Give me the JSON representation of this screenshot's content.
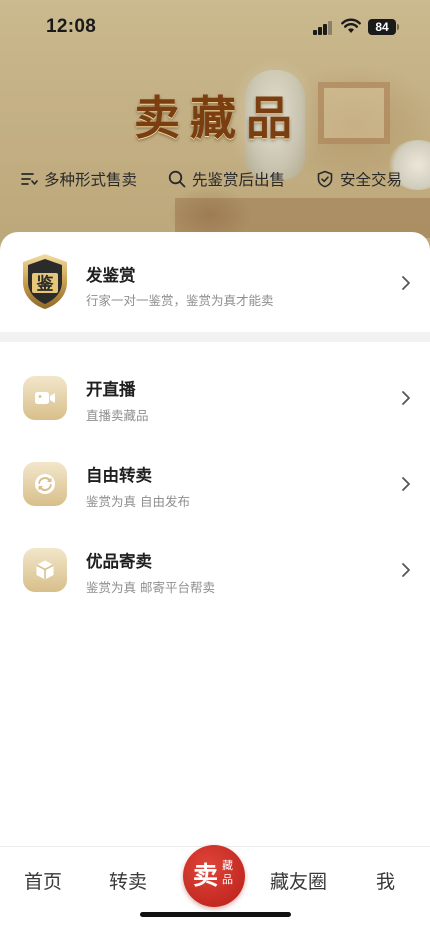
{
  "status_bar": {
    "time": "12:08",
    "battery": "84"
  },
  "hero": {
    "title": "卖藏品",
    "features": [
      {
        "icon": "list-filter-icon",
        "label": "多种形式售卖"
      },
      {
        "icon": "search-icon",
        "label": "先鉴赏后出售"
      },
      {
        "icon": "shield-check-icon",
        "label": "安全交易"
      }
    ]
  },
  "appraisal": {
    "badge_char": "鉴",
    "title": "发鉴赏",
    "subtitle": "行家一对一鉴赏，鉴赏为真才能卖"
  },
  "options": [
    {
      "icon": "video-camera-icon",
      "title": "开直播",
      "subtitle": "直播卖藏品"
    },
    {
      "icon": "transfer-icon",
      "title": "自由转卖",
      "subtitle": "鉴赏为真 自由发布"
    },
    {
      "icon": "package-icon",
      "title": "优品寄卖",
      "subtitle": "鉴赏为真 邮寄平台帮卖"
    }
  ],
  "tabbar": {
    "home": "首页",
    "resell": "转卖",
    "sell_main": "卖",
    "sell_sub1": "藏",
    "sell_sub2": "品",
    "circle": "藏友圈",
    "me": "我"
  },
  "colors": {
    "accent_red": "#c42a22",
    "title_brown": "#7a3e10",
    "icon_gold": "#d8bf8a"
  }
}
